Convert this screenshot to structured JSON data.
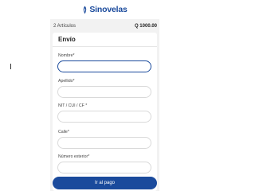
{
  "header": {
    "brand": "Sinovelas"
  },
  "summary": {
    "items_count": "2 Artículos",
    "total": "Q 1000.00"
  },
  "form": {
    "title": "Envío",
    "fields": [
      {
        "label": "Nombre*",
        "value": ""
      },
      {
        "label": "Apellido*",
        "value": ""
      },
      {
        "label": "NIT / CUI / CF *",
        "value": ""
      },
      {
        "label": "Calle*",
        "value": ""
      },
      {
        "label": "Número exterior*",
        "value": ""
      }
    ]
  },
  "actions": {
    "pay_label": "Ir al pago"
  },
  "colors": {
    "brand": "#1a4a9c",
    "background": "#f2f2f2",
    "card": "#ffffff"
  }
}
